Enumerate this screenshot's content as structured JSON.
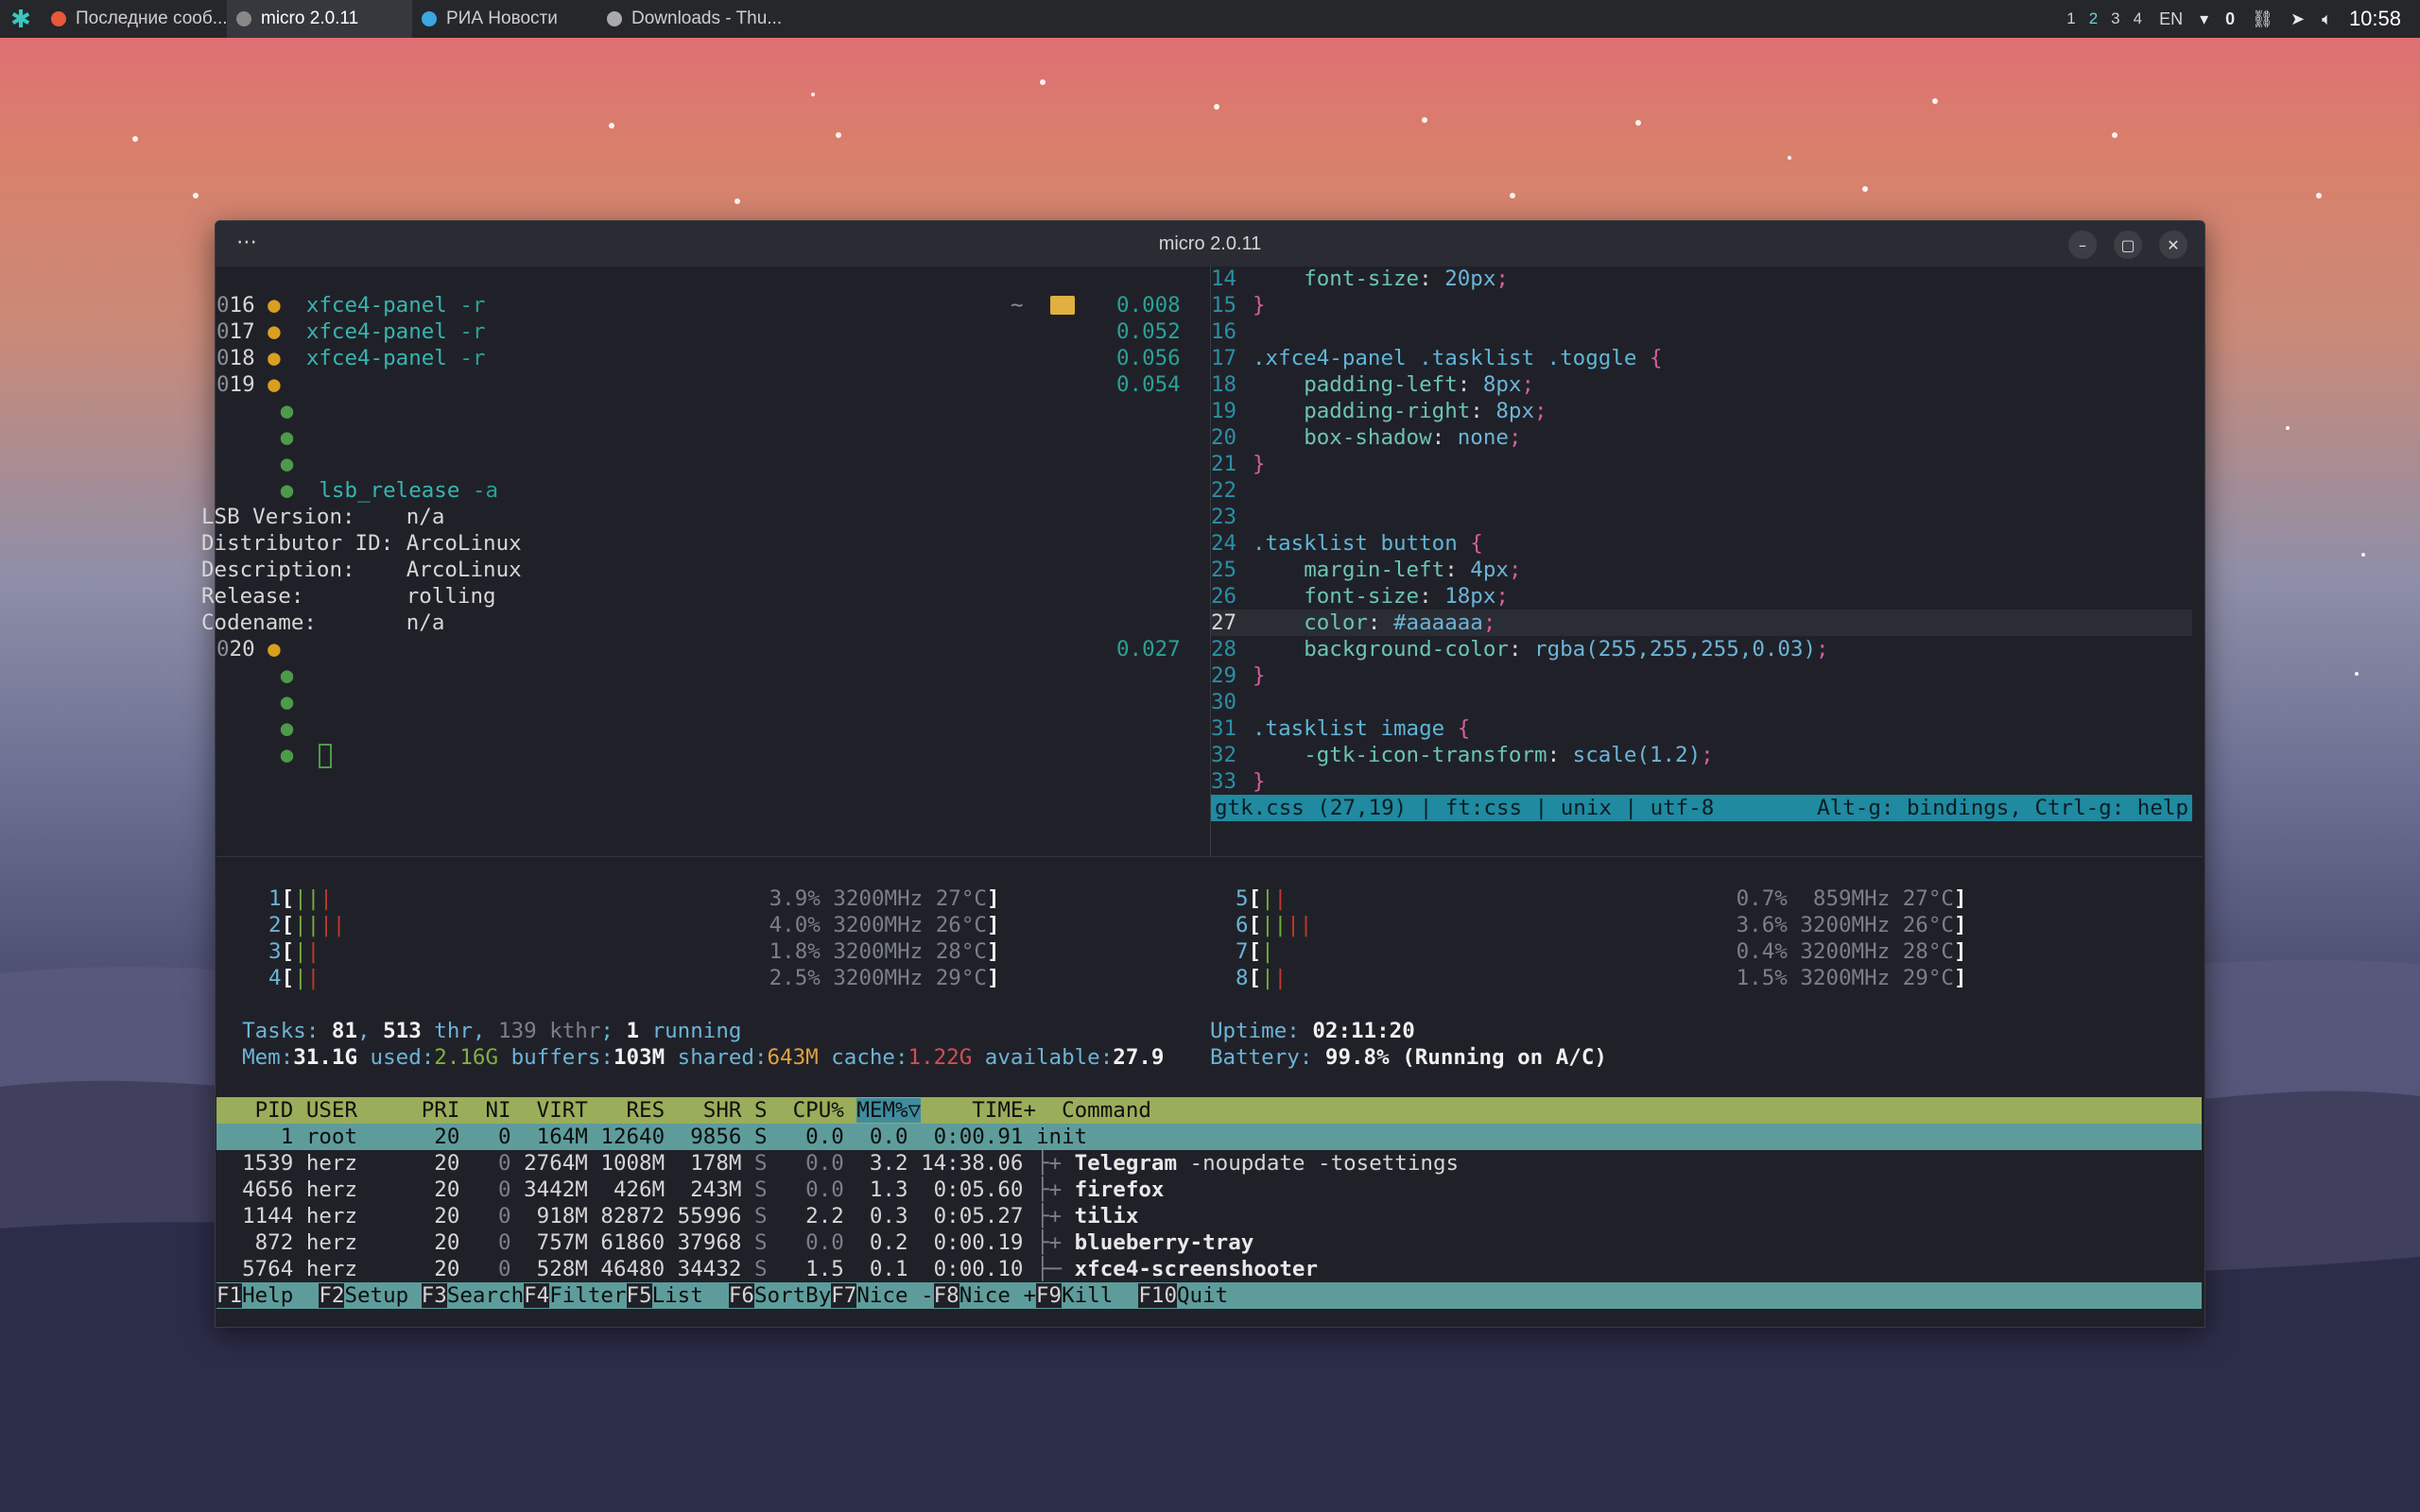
{
  "topbar": {
    "tasks": [
      {
        "label": "Последние сооб...",
        "icon": "firefox-icon",
        "color": "#e8583b"
      },
      {
        "label": "micro 2.0.11",
        "icon": "terminal-icon",
        "color": "#888888",
        "active": true
      },
      {
        "label": "РИА Новости",
        "icon": "telegram-icon",
        "color": "#3aa7de"
      },
      {
        "label": "Downloads - Thu...",
        "icon": "download-icon",
        "color": "#aaaaaa"
      }
    ],
    "workspaces": [
      "1",
      "2",
      "3",
      "4"
    ],
    "current_workspace": "2",
    "lang": "EN",
    "notif_count": "0",
    "clock": "10:58"
  },
  "window": {
    "title": "micro 2.0.11",
    "menu": "⋯",
    "minimize": "–",
    "maximize": "▢",
    "close": "✕"
  },
  "left": {
    "procs": [
      {
        "id": "016",
        "cmd": "xfce4-panel",
        "arg": "-r",
        "time": "0.008"
      },
      {
        "id": "017",
        "cmd": "xfce4-panel",
        "arg": "-r",
        "time": "0.052"
      },
      {
        "id": "018",
        "cmd": "xfce4-panel",
        "arg": "-r",
        "time": "0.056"
      },
      {
        "id": "019",
        "cmd": "",
        "arg": "",
        "time": "0.054"
      }
    ],
    "prompt_tilde": "~",
    "lsb_cmd": "lsb_release",
    "lsb_arg": "-a",
    "lsb": [
      {
        "k": "LSB Version:    ",
        "v": "n/a"
      },
      {
        "k": "Distributor ID: ",
        "v": "ArcoLinux"
      },
      {
        "k": "Description:    ",
        "v": "ArcoLinux"
      },
      {
        "k": "Release:        ",
        "v": "rolling"
      },
      {
        "k": "Codename:       ",
        "v": "n/a"
      }
    ],
    "last_id": "020",
    "last_time": "0.027"
  },
  "editor": {
    "lines": [
      {
        "n": "14",
        "t": "    font-size: 20px;"
      },
      {
        "n": "15",
        "t": "}"
      },
      {
        "n": "16",
        "t": ""
      },
      {
        "n": "17",
        "t": ".xfce4-panel .tasklist .toggle {"
      },
      {
        "n": "18",
        "t": "    padding-left: 8px;"
      },
      {
        "n": "19",
        "t": "    padding-right: 8px;"
      },
      {
        "n": "20",
        "t": "    box-shadow: none;"
      },
      {
        "n": "21",
        "t": "}"
      },
      {
        "n": "22",
        "t": ""
      },
      {
        "n": "23",
        "t": ""
      },
      {
        "n": "24",
        "t": ".tasklist button {"
      },
      {
        "n": "25",
        "t": "    margin-left: 4px;"
      },
      {
        "n": "26",
        "t": "    font-size: 18px;"
      },
      {
        "n": "27",
        "t": "    color: #aaaaaa;"
      },
      {
        "n": "28",
        "t": "    background-color: rgba(255,255,255,0.03);"
      },
      {
        "n": "29",
        "t": "}"
      },
      {
        "n": "30",
        "t": ""
      },
      {
        "n": "31",
        "t": ".tasklist image {"
      },
      {
        "n": "32",
        "t": "    -gtk-icon-transform: scale(1.2);"
      },
      {
        "n": "33",
        "t": "}"
      }
    ],
    "status_left": "gtk.css (27,19) | ft:css | unix | utf-8",
    "status_right": "Alt-g: bindings, Ctrl-g: help"
  },
  "htop": {
    "cpus_left": [
      {
        "n": "1",
        "bar": "|||",
        "stat": "3.9% 3200MHz 27°C"
      },
      {
        "n": "2",
        "bar": "||||",
        "stat": "4.0% 3200MHz 26°C"
      },
      {
        "n": "3",
        "bar": "||",
        "stat": "1.8% 3200MHz 28°C"
      },
      {
        "n": "4",
        "bar": "||",
        "stat": "2.5% 3200MHz 29°C"
      }
    ],
    "cpus_right": [
      {
        "n": "5",
        "bar": "||",
        "stat": "0.7%  859MHz 27°C"
      },
      {
        "n": "6",
        "bar": "||||",
        "stat": "3.6% 3200MHz 26°C"
      },
      {
        "n": "7",
        "bar": "|",
        "stat": "0.4% 3200MHz 28°C"
      },
      {
        "n": "8",
        "bar": "||",
        "stat": "1.5% 3200MHz 29°C"
      }
    ],
    "tasks": "81",
    "thr": "513",
    "kthr": "139",
    "running": "1",
    "uptime": "02:11:20",
    "mem_total": "31.1G",
    "mem_used": "2.16G",
    "buffers": "103M",
    "shared": "643M",
    "cache": "1.22G",
    "available": "27.9",
    "battery": "99.8% (Running on A/C)",
    "header": {
      "pid": "PID",
      "user": "USER",
      "pri": "PRI",
      "ni": "NI",
      "virt": "VIRT",
      "res": "RES",
      "shr": "SHR",
      "s": "S",
      "cpu": "CPU%",
      "mem": "MEM%▽",
      "time": "TIME+",
      "cmd": "Command"
    },
    "rows": [
      {
        "pid": "1",
        "user": "root",
        "pri": "20",
        "ni": "0",
        "virt": "164M",
        "res": "12640",
        "shr": "9856",
        "s": "S",
        "cpu": "0.0",
        "mem": "0.0",
        "time": "0:00.91",
        "tree": "",
        "cmd": "init",
        "args": ""
      },
      {
        "pid": "1539",
        "user": "herz",
        "pri": "20",
        "ni": "0",
        "virt": "2764M",
        "res": "1008M",
        "shr": "178M",
        "s": "S",
        "cpu": "0.0",
        "mem": "3.2",
        "time": "14:38.06",
        "tree": "├+ ",
        "cmd": "Telegram",
        "args": " -noupdate -tosettings"
      },
      {
        "pid": "4656",
        "user": "herz",
        "pri": "20",
        "ni": "0",
        "virt": "3442M",
        "res": "426M",
        "shr": "243M",
        "s": "S",
        "cpu": "0.0",
        "mem": "1.3",
        "time": "0:05.60",
        "tree": "├+ ",
        "cmd": "firefox",
        "args": ""
      },
      {
        "pid": "1144",
        "user": "herz",
        "pri": "20",
        "ni": "0",
        "virt": "918M",
        "res": "82872",
        "shr": "55996",
        "s": "S",
        "cpu": "2.2",
        "mem": "0.3",
        "time": "0:05.27",
        "tree": "├+ ",
        "cmd": "tilix",
        "args": ""
      },
      {
        "pid": "872",
        "user": "herz",
        "pri": "20",
        "ni": "0",
        "virt": "757M",
        "res": "61860",
        "shr": "37968",
        "s": "S",
        "cpu": "0.0",
        "mem": "0.2",
        "time": "0:00.19",
        "tree": "├+ ",
        "cmd": "blueberry-tray",
        "args": ""
      },
      {
        "pid": "5764",
        "user": "herz",
        "pri": "20",
        "ni": "0",
        "virt": "528M",
        "res": "46480",
        "shr": "34432",
        "s": "S",
        "cpu": "1.5",
        "mem": "0.1",
        "time": "0:00.10",
        "tree": "├─ ",
        "cmd": "xfce4-screenshooter",
        "args": ""
      }
    ],
    "fkeys": [
      {
        "k": "F1",
        "l": "Help  "
      },
      {
        "k": "F2",
        "l": "Setup "
      },
      {
        "k": "F3",
        "l": "Search"
      },
      {
        "k": "F4",
        "l": "Filter"
      },
      {
        "k": "F5",
        "l": "List  "
      },
      {
        "k": "F6",
        "l": "SortBy"
      },
      {
        "k": "F7",
        "l": "Nice -"
      },
      {
        "k": "F8",
        "l": "Nice +"
      },
      {
        "k": "F9",
        "l": "Kill  "
      },
      {
        "k": "F10",
        "l": "Quit"
      }
    ]
  }
}
